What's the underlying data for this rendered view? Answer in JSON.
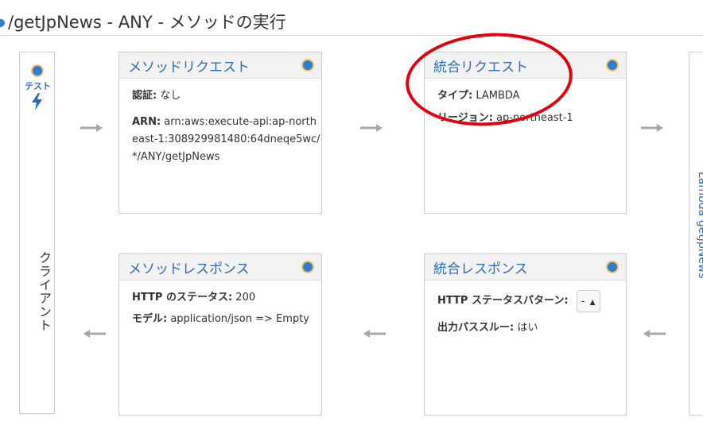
{
  "page": {
    "title": "/getJpNews - ANY - メソッドの実行"
  },
  "client": {
    "test_label": "テスト",
    "test_icon": "lightning-bolt-icon",
    "vertical_label": "クライアント"
  },
  "method_request": {
    "title": "メソッドリクエスト",
    "auth_label": "認証:",
    "auth_value": " なし",
    "arn_label": "ARN:",
    "arn_value": " arn:aws:execute-api:ap-northeast-1:308929981480:64dneqe5wc/*/ANY/getJpNews"
  },
  "integration_request": {
    "title": "統合リクエスト",
    "type_label": "タイプ:",
    "type_value": " LAMBDA",
    "region_label": "リージョン:",
    "region_value": " ap-northeast-1"
  },
  "method_response": {
    "title": "メソッドレスポンス",
    "status_label": "HTTP のステータス:",
    "status_value": " 200",
    "model_label": "モデル:",
    "model_value": " application/json => Empty"
  },
  "integration_response": {
    "title": "統合レスポンス",
    "pattern_label": "HTTP ステータスパターン:",
    "pattern_value": "-",
    "passthrough_label": "出力パススルー:",
    "passthrough_value": " はい"
  },
  "right_panel": {
    "vertical_label": "Lambda getJpNews"
  },
  "colors": {
    "accent": "#2d6db5",
    "status_dot": "#2d7dd2",
    "status_ring": "#f5c16c",
    "highlight": "#e3000f"
  }
}
